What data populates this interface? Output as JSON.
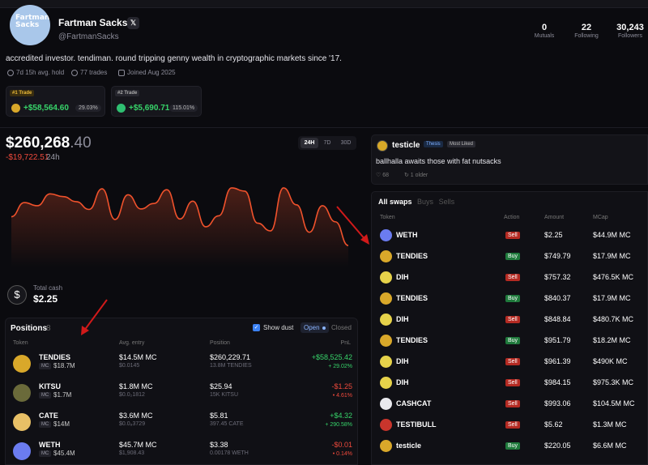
{
  "profile": {
    "avatar_text": "Fartman\nSacks",
    "name": "Fartman Sacks",
    "x_label": "𝕏",
    "handle": "@FartmanSacks",
    "bio": "accredited investor. tendiman. round tripping genny wealth in cryptographic markets since '17.",
    "hold": "7d 15h avg. hold",
    "trades": "77 trades",
    "joined": "Joined Aug 2025",
    "stats": [
      {
        "value": "0",
        "label": "Mutuals"
      },
      {
        "value": "22",
        "label": "Following"
      },
      {
        "value": "30,243",
        "label": "Followers"
      }
    ]
  },
  "top_trades": [
    {
      "tag": "#1 Trade",
      "amount": "+$58,564.60",
      "pct": "29.03%",
      "coin_color": "#d9a82a",
      "tag_color": "#d9a82a"
    },
    {
      "tag": "#2 Trade",
      "amount": "+$5,690.71",
      "pct": "115.01%",
      "coin_color": "#2fbf71",
      "tag_color": "#9a9aa6"
    }
  ],
  "portfolio": {
    "balance_main": "$260,268",
    "balance_decimal": ".40",
    "change": "-$19,722.51",
    "period": "24h",
    "timeframes": [
      "24H",
      "7D",
      "30D"
    ],
    "active_timeframe": "24H",
    "line_values": [
      100,
      131,
      124,
      150,
      144,
      133,
      116,
      161,
      94,
      148,
      117,
      129,
      159,
      95,
      134,
      78,
      102,
      163,
      156,
      86,
      69,
      163,
      126,
      66,
      124,
      89,
      37
    ],
    "line_color": "#f0522c"
  },
  "cash": {
    "label": "Total cash",
    "value": "$2.25",
    "icon": "dollar-icon"
  },
  "positions": {
    "title": "Positions",
    "count": "8",
    "show_dust": "Show dust",
    "open_label": "Open",
    "closed_label": "Closed",
    "headers": [
      "Token",
      "Avg. entry",
      "Position",
      "PnL"
    ],
    "rows": [
      {
        "token": "TENDIES",
        "mc": "$18.7M",
        "entry": "$14.5M MC",
        "entry_sub": "$0.0145",
        "value": "$260,229.71",
        "value_sub": "13.8M TENDIES",
        "pnl": "+$58,525.42",
        "pnl_pct": "+ 29.02%",
        "positive": true,
        "coin_color": "#d9a82a"
      },
      {
        "token": "KITSU",
        "mc": "$1.7M",
        "entry": "$1.8M MC",
        "entry_sub": "$0.0₂1812",
        "value": "$25.94",
        "value_sub": "15K KITSU",
        "pnl": "-$1.25",
        "pnl_pct": "• 4.61%",
        "positive": false,
        "coin_color": "#6a6a3a"
      },
      {
        "token": "CATE",
        "mc": "$14M",
        "entry": "$3.6M MC",
        "entry_sub": "$0.0₈3729",
        "value": "$5.81",
        "value_sub": "397.45 CATE",
        "pnl": "+$4.32",
        "pnl_pct": "+ 290.58%",
        "positive": true,
        "coin_color": "#e8c066"
      },
      {
        "token": "WETH",
        "mc": "$45.4M",
        "entry": "$45.7M MC",
        "entry_sub": "$1,908.43",
        "value": "$3.38",
        "value_sub": "0.00178 WETH",
        "pnl": "-$0.01",
        "pnl_pct": "• 0.14%",
        "positive": false,
        "coin_color": "#6b7cf0"
      }
    ]
  },
  "post": {
    "user": "testicle",
    "thesis_tag": "Thesis",
    "liked_tag": "Most Liked",
    "text": "ballhalla awaits those with fat nutsacks",
    "likes": "♡ 68",
    "replies": "↻ 1 older"
  },
  "swaps": {
    "tabs": [
      "All swaps",
      "Buys",
      "Sells"
    ],
    "active_tab": "All swaps",
    "headers": [
      "Token",
      "Action",
      "Amount",
      "MCap"
    ],
    "rows": [
      {
        "token": "WETH",
        "action": "Sell",
        "amount": "$2.25",
        "mcap": "$44.9M MC",
        "coin_color": "#6b7cf0"
      },
      {
        "token": "TENDIES",
        "action": "Buy",
        "amount": "$749.79",
        "mcap": "$17.9M MC",
        "coin_color": "#d9a82a"
      },
      {
        "token": "DIH",
        "action": "Sell",
        "amount": "$757.32",
        "mcap": "$476.5K MC",
        "coin_color": "#e6d24a"
      },
      {
        "token": "TENDIES",
        "action": "Buy",
        "amount": "$840.37",
        "mcap": "$17.9M MC",
        "coin_color": "#d9a82a"
      },
      {
        "token": "DIH",
        "action": "Sell",
        "amount": "$848.84",
        "mcap": "$480.7K MC",
        "coin_color": "#e6d24a"
      },
      {
        "token": "TENDIES",
        "action": "Buy",
        "amount": "$951.79",
        "mcap": "$18.2M MC",
        "coin_color": "#d9a82a"
      },
      {
        "token": "DIH",
        "action": "Sell",
        "amount": "$961.39",
        "mcap": "$490K MC",
        "coin_color": "#e6d24a"
      },
      {
        "token": "DIH",
        "action": "Sell",
        "amount": "$984.15",
        "mcap": "$975.3K MC",
        "coin_color": "#e6d24a"
      },
      {
        "token": "CASHCAT",
        "action": "Sell",
        "amount": "$993.06",
        "mcap": "$104.5M MC",
        "coin_color": "#e9e9ee"
      },
      {
        "token": "TESTIBULL",
        "action": "Sell",
        "amount": "$5.62",
        "mcap": "$1.3M MC",
        "coin_color": "#c9352c"
      },
      {
        "token": "testicle",
        "action": "Buy",
        "amount": "$220.05",
        "mcap": "$6.6M MC",
        "coin_color": "#d9a82a"
      }
    ]
  },
  "annotation_color": "#d11a1a"
}
